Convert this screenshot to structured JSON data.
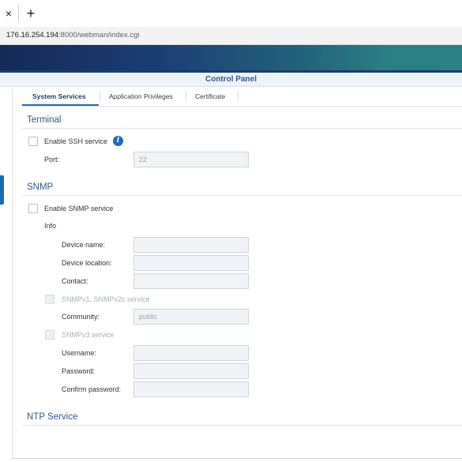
{
  "browser": {
    "tab_close": "×",
    "new_tab": "+",
    "url_host": "176.16.254.194",
    "url_rest": ":8000/webman/index.cgi"
  },
  "window": {
    "title": "Control Panel"
  },
  "tabs": [
    {
      "label": "System Services",
      "active": true
    },
    {
      "label": "Application Privileges",
      "active": false
    },
    {
      "label": "Certificate",
      "active": false
    }
  ],
  "terminal": {
    "title": "Terminal",
    "ssh_label": "Enable SSH service",
    "ssh_checked": false,
    "info_icon": "i",
    "port_label": "Port:",
    "port_value": "22"
  },
  "snmp": {
    "title": "SNMP",
    "enable_label": "Enable SNMP service",
    "enable_checked": false,
    "info_label": "Info",
    "device_name_label": "Device name:",
    "device_name_value": "",
    "device_location_label": "Device location:",
    "device_location_value": "",
    "contact_label": "Contact:",
    "contact_value": "",
    "v1v2_label": "SNMPv1, SNMPv2c service",
    "community_label": "Community:",
    "community_value": "public",
    "v3_label": "SNMPv3 service",
    "username_label": "Username:",
    "username_value": "",
    "password_label": "Password:",
    "password_value": "",
    "confirm_password_label": "Confirm password:",
    "confirm_password_value": ""
  },
  "ntp": {
    "title": "NTP Service"
  },
  "colors": {
    "accent": "#1d69b5",
    "section_title": "#2c5a8a",
    "banner_start": "#132a56",
    "banner_end": "#2a7f89"
  }
}
